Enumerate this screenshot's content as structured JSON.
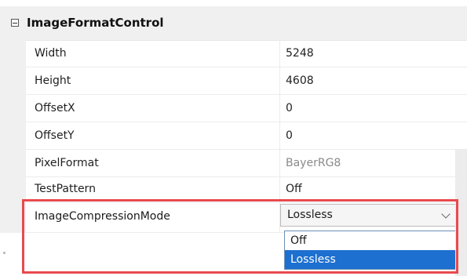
{
  "category": {
    "title": "ImageFormatControl",
    "expanded": true
  },
  "properties": [
    {
      "name": "Width",
      "value": "5248",
      "readonly": false
    },
    {
      "name": "Height",
      "value": "4608",
      "readonly": false
    },
    {
      "name": "OffsetX",
      "value": "0",
      "readonly": false
    },
    {
      "name": "OffsetY",
      "value": "0",
      "readonly": false
    },
    {
      "name": "PixelFormat",
      "value": "BayerRG8",
      "readonly": true
    },
    {
      "name": "TestPattern",
      "value": "Off",
      "readonly": false
    }
  ],
  "selected_property": {
    "name": "ImageCompressionMode",
    "value": "Lossless",
    "options": [
      "Off",
      "Lossless"
    ],
    "highlighted_option": "Lossless"
  },
  "colors": {
    "highlight_border": "#e84a4f",
    "selection_blue": "#1d6fd0",
    "category_bg": "#f0f0f0"
  },
  "icons": {
    "category_toggle": "collapse-minus-icon",
    "dropdown_arrow": "chevron-down-icon"
  }
}
